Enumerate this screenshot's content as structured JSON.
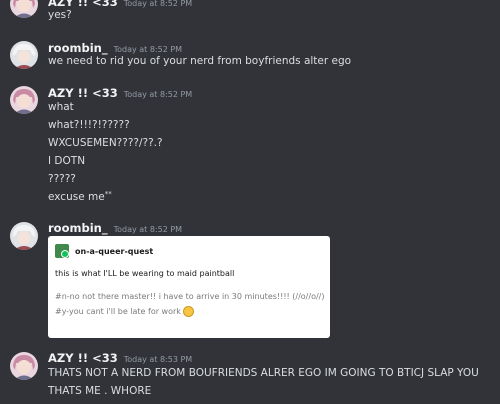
{
  "messages": [
    {
      "author": "AZY !! <33",
      "timestamp": "Today at 8:52 PM",
      "avatar": "pink-haired-character-avatar",
      "lines": [
        "yes?"
      ]
    },
    {
      "author": "roombin_",
      "timestamp": "Today at 8:52 PM",
      "avatar": "white-haired-character-avatar",
      "lines": [
        "we need to rid you of your nerd from boyfriends alter ego"
      ]
    },
    {
      "author": "AZY !! <33",
      "timestamp": "Today at 8:52 PM",
      "avatar": "pink-haired-character-avatar",
      "lines": [
        "what",
        "what?!!!?!?????",
        "WXCUSEMEN????/??.?",
        "I DOTN",
        "?????",
        "excuse me",
        "**"
      ]
    },
    {
      "author": "roombin_",
      "timestamp": "Today at 8:52 PM",
      "avatar": "white-haired-character-avatar",
      "lines": [],
      "embed": {
        "blog_name": "on-a-queer-quest",
        "body": "this is what I'LL be wearing to maid paintball",
        "tags": [
          "#n-no not there master!! i have to arrive in 30 minutes!!!! (//o//o//)",
          "#y-you cant i'll be late for work"
        ],
        "emoji": "weary-face-emoji"
      }
    },
    {
      "author": "AZY !! <33",
      "timestamp": "Today at 8:53 PM",
      "avatar": "pink-haired-character-avatar",
      "lines": [
        "THATS NOT A NERD FROM BOUFRIENDS ALRER EGO IM GOING TO BTICJ SLAP YOU",
        "THATS ME . WHORE"
      ]
    }
  ],
  "colors": {
    "background": "#313338",
    "author": "#f2f3f5",
    "text": "#dbdee1",
    "timestamp": "#949ba4"
  }
}
